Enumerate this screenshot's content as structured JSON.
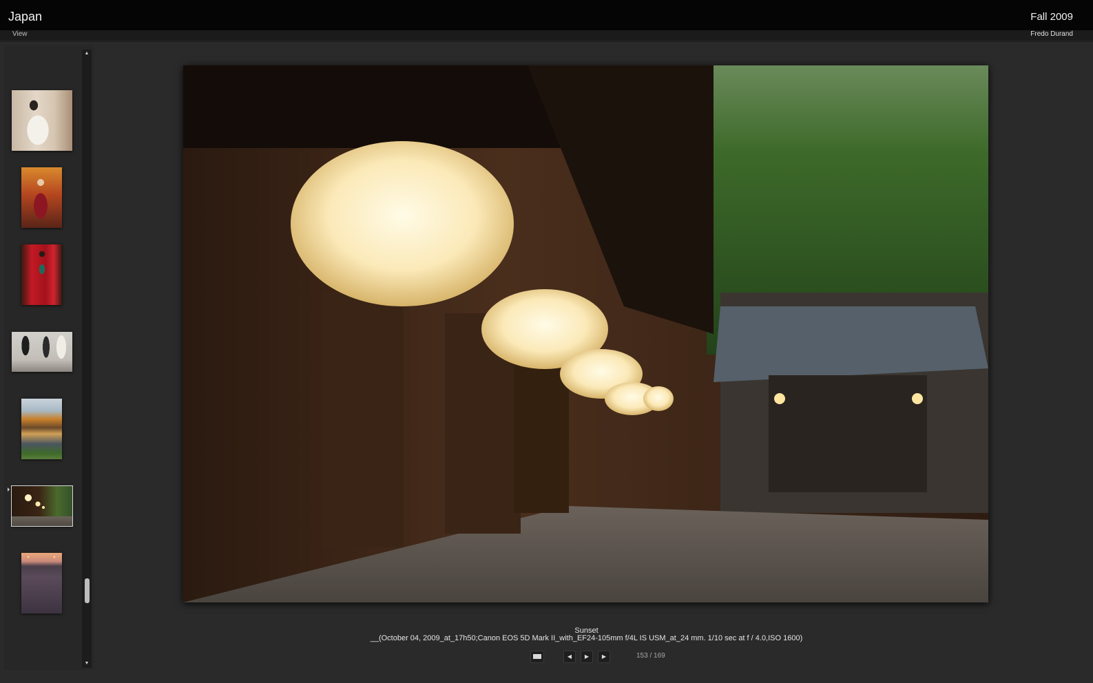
{
  "header": {
    "site_title": "Japan",
    "collection_title": "Fall 2009",
    "view_menu": "View",
    "author": "Fredo Durand"
  },
  "filmstrip": {
    "scroll_up_icon": "▲",
    "scroll_down_icon": "▼",
    "thumbnails": [
      {
        "subject": "priest in white robe"
      },
      {
        "subject": "woman in red kimono"
      },
      {
        "subject": "red kimono detail"
      },
      {
        "subject": "wedding procession"
      },
      {
        "subject": "pavilion reflection"
      },
      {
        "subject": "temple lanterns",
        "selected": true
      },
      {
        "subject": "street at dusk"
      }
    ],
    "selected_index": 5,
    "scroll_position": 0.86
  },
  "photo": {
    "title": "Sunset",
    "metadata": "__(October 04, 2009_at_17h50;Canon EOS 5D Mark II_with_EF24-105mm f/4L IS USM_at_24 mm. 1/10 sec at f / 4.0,ISO 1600)"
  },
  "controls": {
    "display_icon": "display-mode-icon",
    "prev_icon": "◀",
    "play_icon": "▶",
    "next_icon": "▶",
    "counter": "153 / 169"
  },
  "colors": {
    "background": "#2a2a2a",
    "topbar": "#050505"
  }
}
